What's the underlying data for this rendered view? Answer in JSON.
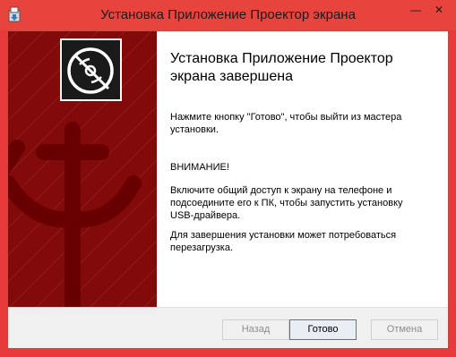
{
  "window": {
    "title": "Установка Приложение Проектор экрана",
    "minimize_glyph": "—",
    "close_glyph": "✕"
  },
  "content": {
    "heading": "Установка Приложение Проектор экрана завершена",
    "instruction": "Нажмите кнопку \"Готово\", чтобы выйти из мастера\nустановки.",
    "warning_title": "ВНИМАНИЕ!",
    "warning_text": "Включите общий доступ к экрану на телефоне и\nподсоедините его к ПК, чтобы запустить установку\nUSB-драйвера.",
    "reboot_note": "Для завершения установки может потребоваться\nперезагрузка."
  },
  "buttons": {
    "back_label": "Назад",
    "finish_label": "Готово",
    "cancel_label": "Отмена"
  },
  "colors": {
    "titlebar": "#e8443e",
    "banner_dark": "#8e0c0c",
    "banner_anchor": "#7a0000",
    "footer": "#f0f0f0"
  },
  "icons": {
    "app": "installer-box-icon",
    "banner": "disc-installer-icon"
  }
}
